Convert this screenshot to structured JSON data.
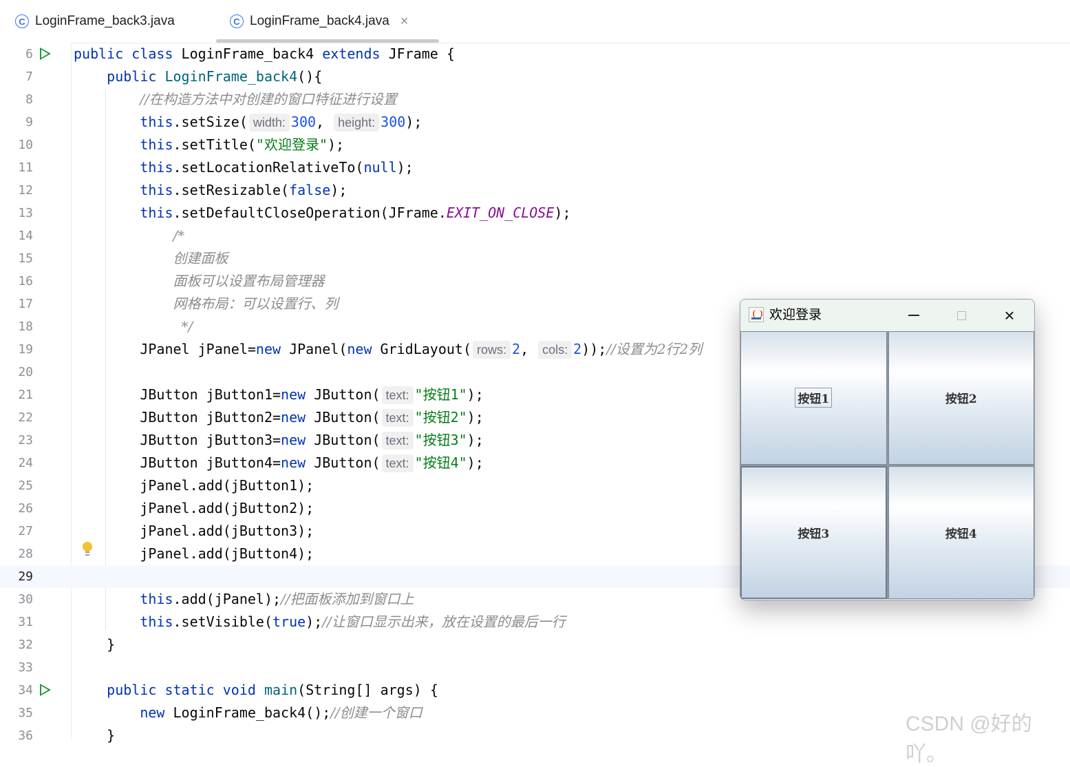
{
  "tabs": [
    {
      "icon": "class-icon",
      "icon_text": "C",
      "label": "LoginFrame_back3.java",
      "active": false
    },
    {
      "icon": "class-icon",
      "icon_text": "C",
      "label": "LoginFrame_back4.java",
      "active": true,
      "close": "×"
    }
  ],
  "editor": {
    "line_numbers": [
      "6",
      "7",
      "8",
      "9",
      "10",
      "11",
      "12",
      "13",
      "14",
      "15",
      "16",
      "17",
      "18",
      "19",
      "20",
      "21",
      "22",
      "23",
      "24",
      "25",
      "26",
      "27",
      "28",
      "29",
      "30",
      "31",
      "32",
      "33",
      "34",
      "35",
      "36"
    ],
    "current_line": "29",
    "lines": [
      {
        "n": "6",
        "run": true,
        "tokens": [
          [
            "kw",
            "public "
          ],
          [
            "kw",
            "class "
          ],
          [
            "",
            "LoginFrame_back4 "
          ],
          [
            "kw",
            "extends "
          ],
          [
            "",
            "JFrame {"
          ]
        ]
      },
      {
        "n": "7",
        "tokens": [
          [
            "",
            "    "
          ],
          [
            "kw",
            "public "
          ],
          [
            "fn",
            "LoginFrame_back4"
          ],
          [
            "",
            "(){"
          ]
        ]
      },
      {
        "n": "8",
        "tokens": [
          [
            "",
            "        "
          ],
          [
            "cm",
            "//在构造方法中对创建的窗口特征进行设置"
          ]
        ]
      },
      {
        "n": "9",
        "tokens": [
          [
            "",
            "        "
          ],
          [
            "kw",
            "this"
          ],
          [
            "",
            ".setSize("
          ],
          [
            "hint",
            "width:"
          ],
          [
            "num",
            "300"
          ],
          [
            "",
            ", "
          ],
          [
            "hint",
            "height:"
          ],
          [
            "num",
            "300"
          ],
          [
            "",
            ");"
          ]
        ]
      },
      {
        "n": "10",
        "tokens": [
          [
            "",
            "        "
          ],
          [
            "kw",
            "this"
          ],
          [
            "",
            ".setTitle("
          ],
          [
            "str",
            "\"欢迎登录\""
          ],
          [
            "",
            ");"
          ]
        ]
      },
      {
        "n": "11",
        "tokens": [
          [
            "",
            "        "
          ],
          [
            "kw",
            "this"
          ],
          [
            "",
            ".setLocationRelativeTo("
          ],
          [
            "kw",
            "null"
          ],
          [
            "",
            ");"
          ]
        ]
      },
      {
        "n": "12",
        "tokens": [
          [
            "",
            "        "
          ],
          [
            "kw",
            "this"
          ],
          [
            "",
            ".setResizable("
          ],
          [
            "kw",
            "false"
          ],
          [
            "",
            ");"
          ]
        ]
      },
      {
        "n": "13",
        "tokens": [
          [
            "",
            "        "
          ],
          [
            "kw",
            "this"
          ],
          [
            "",
            ".setDefaultCloseOperation(JFrame."
          ],
          [
            "fld",
            "EXIT_ON_CLOSE"
          ],
          [
            "",
            ");"
          ]
        ]
      },
      {
        "n": "14",
        "tokens": [
          [
            "",
            "            "
          ],
          [
            "cm",
            "/*"
          ]
        ]
      },
      {
        "n": "15",
        "tokens": [
          [
            "",
            "            "
          ],
          [
            "cm",
            "创建面板"
          ]
        ]
      },
      {
        "n": "16",
        "tokens": [
          [
            "",
            "            "
          ],
          [
            "cm",
            "面板可以设置布局管理器"
          ]
        ]
      },
      {
        "n": "17",
        "tokens": [
          [
            "",
            "            "
          ],
          [
            "cm",
            "网格布局：可以设置行、列"
          ]
        ]
      },
      {
        "n": "18",
        "tokens": [
          [
            "",
            "             "
          ],
          [
            "cm",
            "*/"
          ]
        ]
      },
      {
        "n": "19",
        "tokens": [
          [
            "",
            "        JPanel jPanel="
          ],
          [
            "kw",
            "new "
          ],
          [
            "",
            "JPanel("
          ],
          [
            "kw",
            "new "
          ],
          [
            "",
            "GridLayout("
          ],
          [
            "hint",
            "rows:"
          ],
          [
            "num",
            "2"
          ],
          [
            "",
            ", "
          ],
          [
            "hint",
            "cols:"
          ],
          [
            "num",
            "2"
          ],
          [
            "",
            "));"
          ],
          [
            "cm",
            "//设置为2行2列"
          ]
        ]
      },
      {
        "n": "20",
        "tokens": []
      },
      {
        "n": "21",
        "tokens": [
          [
            "",
            "        JButton jButton1="
          ],
          [
            "kw",
            "new "
          ],
          [
            "",
            "JButton("
          ],
          [
            "hint",
            "text:"
          ],
          [
            "str",
            "\"按钮1\""
          ],
          [
            "",
            ");"
          ]
        ]
      },
      {
        "n": "22",
        "tokens": [
          [
            "",
            "        JButton jButton2="
          ],
          [
            "kw",
            "new "
          ],
          [
            "",
            "JButton("
          ],
          [
            "hint",
            "text:"
          ],
          [
            "str",
            "\"按钮2\""
          ],
          [
            "",
            ");"
          ]
        ]
      },
      {
        "n": "23",
        "tokens": [
          [
            "",
            "        JButton jButton3="
          ],
          [
            "kw",
            "new "
          ],
          [
            "",
            "JButton("
          ],
          [
            "hint",
            "text:"
          ],
          [
            "str",
            "\"按钮3\""
          ],
          [
            "",
            ");"
          ]
        ]
      },
      {
        "n": "24",
        "tokens": [
          [
            "",
            "        JButton jButton4="
          ],
          [
            "kw",
            "new "
          ],
          [
            "",
            "JButton("
          ],
          [
            "hint",
            "text:"
          ],
          [
            "str",
            "\"按钮4\""
          ],
          [
            "",
            ");"
          ]
        ]
      },
      {
        "n": "25",
        "tokens": [
          [
            "",
            "        jPanel.add(jButton1);"
          ]
        ]
      },
      {
        "n": "26",
        "tokens": [
          [
            "",
            "        jPanel.add(jButton2);"
          ]
        ]
      },
      {
        "n": "27",
        "tokens": [
          [
            "",
            "        jPanel.add(jButton3);"
          ]
        ]
      },
      {
        "n": "28",
        "tokens": [
          [
            "",
            "        jPanel.add(jButton4);"
          ]
        ]
      },
      {
        "n": "29",
        "tokens": []
      },
      {
        "n": "30",
        "tokens": [
          [
            "",
            "        "
          ],
          [
            "kw",
            "this"
          ],
          [
            "",
            ".add(jPanel);"
          ],
          [
            "cm",
            "//把面板添加到窗口上"
          ]
        ]
      },
      {
        "n": "31",
        "tokens": [
          [
            "",
            "        "
          ],
          [
            "kw",
            "this"
          ],
          [
            "",
            ".setVisible("
          ],
          [
            "kw",
            "true"
          ],
          [
            "",
            ");"
          ],
          [
            "cm",
            "//让窗口显示出来，放在设置的最后一行"
          ]
        ]
      },
      {
        "n": "32",
        "tokens": [
          [
            "",
            "    }"
          ]
        ]
      },
      {
        "n": "33",
        "tokens": []
      },
      {
        "n": "34",
        "run": true,
        "tokens": [
          [
            "",
            "    "
          ],
          [
            "kw",
            "public "
          ],
          [
            "kw",
            "static "
          ],
          [
            "kw",
            "void "
          ],
          [
            "fn",
            "main"
          ],
          [
            "",
            "(String[] args) {"
          ]
        ]
      },
      {
        "n": "35",
        "tokens": [
          [
            "",
            "        "
          ],
          [
            "kw",
            "new "
          ],
          [
            "",
            "LoginFrame_back4();"
          ],
          [
            "cm",
            "//创建一个窗口"
          ]
        ]
      },
      {
        "n": "36",
        "tokens": [
          [
            "",
            "    }"
          ]
        ]
      }
    ]
  },
  "window": {
    "title": "欢迎登录",
    "icon": "java-icon",
    "buttons": [
      "按钮1",
      "按钮2",
      "按钮3",
      "按钮4"
    ],
    "controls": {
      "minimize": "minimize-icon",
      "maximize": "maximize-icon",
      "close": "×"
    }
  },
  "watermark": "CSDN @好的吖。"
}
